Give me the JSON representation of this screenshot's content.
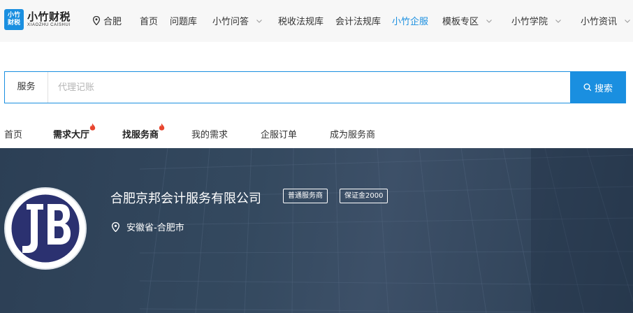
{
  "logo": {
    "badge_line1": "小竹",
    "badge_line2": "财税",
    "name": "小竹财税",
    "sub": "XIAOZHU CAISHUI"
  },
  "location": "合肥",
  "nav": {
    "items": [
      {
        "label": "首页"
      },
      {
        "label": "问题库"
      },
      {
        "label": "小竹问答",
        "dropdown": true
      },
      {
        "label": "税收法规库"
      },
      {
        "label": "会计法规库"
      },
      {
        "label": "小竹企服",
        "active": true
      },
      {
        "label": "模板专区",
        "dropdown": true
      },
      {
        "label": "小竹学院",
        "dropdown": true
      },
      {
        "label": "小竹资讯",
        "dropdown": true
      }
    ]
  },
  "search": {
    "category": "服务",
    "placeholder": "代理记账",
    "value": "",
    "button_label": "搜索"
  },
  "subtabs": [
    {
      "label": "首页"
    },
    {
      "label": "需求大厅",
      "hot": true
    },
    {
      "label": "找服务商",
      "hot": true
    },
    {
      "label": "我的需求"
    },
    {
      "label": "企服订单"
    },
    {
      "label": "成为服务商"
    }
  ],
  "provider": {
    "name": "合肥京邦会计服务有限公司",
    "badges": [
      "普通服务商",
      "保证金2000"
    ],
    "region": "安徽省-合肥市",
    "logo_text": "JB"
  },
  "colors": {
    "accent": "#1a8fe0",
    "banner": "#34495f",
    "hot": "#e8452e",
    "logo_navy": "#2b3170"
  }
}
